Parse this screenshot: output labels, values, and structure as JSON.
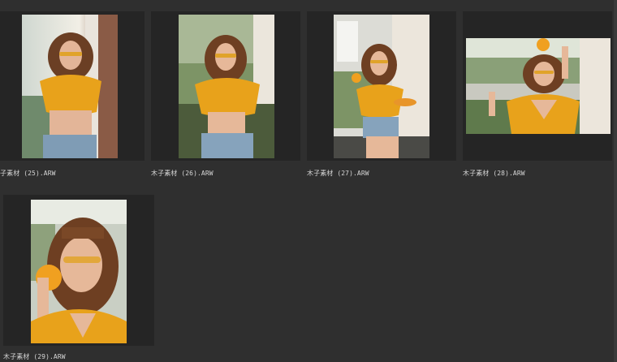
{
  "thumbnails": [
    {
      "filename": "子素材 (25).ARW",
      "orientation": "portrait"
    },
    {
      "filename": "木子素材 (26).ARW",
      "orientation": "portrait"
    },
    {
      "filename": "木子素材 (27).ARW",
      "orientation": "portrait"
    },
    {
      "filename": "木子素材 (28).ARW",
      "orientation": "landscape"
    },
    {
      "filename": "木子素材 (29).ARW",
      "orientation": "portrait"
    }
  ],
  "colors": {
    "background": "#2f2f2f",
    "cell": "#252525",
    "label": "#d6d6d6",
    "accent_top": "#e5a21e"
  }
}
